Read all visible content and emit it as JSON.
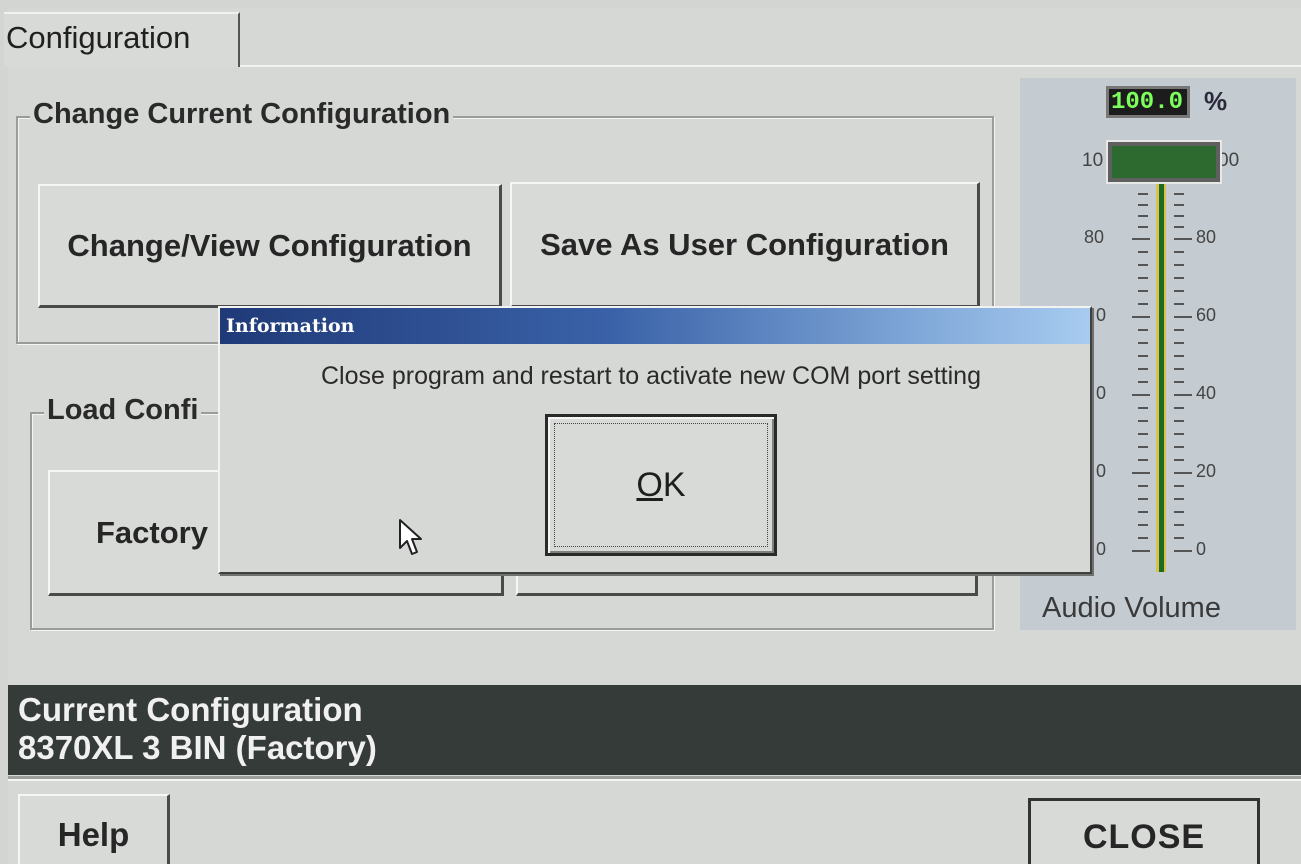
{
  "tabs": [
    {
      "label": "Configuration"
    }
  ],
  "change_group": {
    "title": "Change Current Configuration",
    "change_view_label": "Change/View Configuration",
    "save_user_label": "Save As User Configuration"
  },
  "load_group": {
    "title": "Load Confi",
    "factory_label": "Factory"
  },
  "volume": {
    "value": "100.0",
    "unit": "%",
    "label_top_left": "10",
    "label_top_right": "00",
    "left_scale": [
      "80",
      "0",
      "0",
      "0",
      "0"
    ],
    "right_scale": [
      "80",
      "60",
      "40",
      "20",
      "0"
    ],
    "caption": "Audio Volume",
    "level_percent": 100
  },
  "current": {
    "heading": "Current Configuration",
    "value": "8370XL 3 BIN (Factory)"
  },
  "footer": {
    "help_label": "Help",
    "close_label": "CLOSE"
  },
  "dialog": {
    "title": "Information",
    "message": "Close program and restart to activate new COM port setting",
    "ok_mnemonic": "O",
    "ok_rest": "K"
  },
  "colors": {
    "dialog_title_start": "#203a78",
    "dialog_title_end": "#a8ccf0",
    "volume_readout": "#7cff5c",
    "status_bar": "#353b38"
  }
}
